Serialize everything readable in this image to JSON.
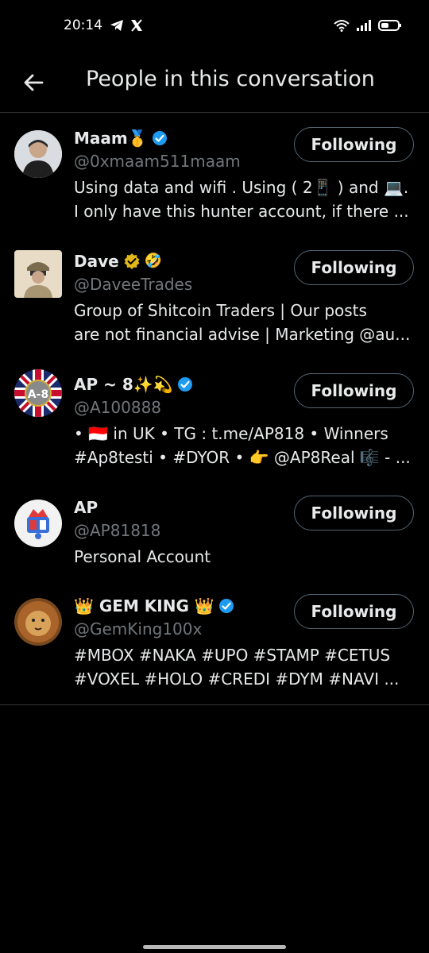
{
  "status": {
    "time": "20:14",
    "left_icons": [
      "telegram-icon",
      "x-logo-icon"
    ],
    "right_icons": [
      "wifi-icon",
      "signal-icon",
      "battery-icon"
    ]
  },
  "header": {
    "title": "People in this conversation",
    "back_icon": "back-arrow-icon"
  },
  "colors": {
    "background": "#000000",
    "text": "#e7e9ea",
    "muted": "#71767b",
    "verified_blue": "#1d9bf0",
    "verified_gold": "#e2b719",
    "divider": "#2f3336"
  },
  "people": [
    {
      "name": "Maam🥇",
      "badge": "verified-blue",
      "handle": "@0xmaam511maam",
      "bio": [
        "Using data and wifi . Using ( 2📱 ) and 💻.",
        "I only have this hunter account, if there ..."
      ],
      "button": "Following"
    },
    {
      "name": "Dave",
      "badge": "verified-gold",
      "extra_emoji": "🤣",
      "handle": "@DaveeTrades",
      "bio": [
        "Group of Shitcoin Traders | Our posts",
        "are not financial advise | Marketing @au..."
      ],
      "button": "Following"
    },
    {
      "name": "AP ~ 8✨💫",
      "badge": "verified-blue",
      "handle": "@A100888",
      "bio": [
        "• 🇮🇩 in UK  • TG : t.me/AP818 • Winners",
        "#Ap8testi • #DYOR • 👉 @AP8Real 🎼 - ..."
      ],
      "button": "Following"
    },
    {
      "name": "AP",
      "badge": "",
      "handle": "@AP81818",
      "bio": [
        "Personal Account"
      ],
      "button": "Following"
    },
    {
      "name": "👑 GEM KING 👑",
      "badge": "verified-blue",
      "handle": "@GemKing100x",
      "bio": [
        "#MBOX #NAKA #UPO #STAMP #CETUS",
        "#VOXEL #HOLO #CREDI #DYM #NAVI ..."
      ],
      "button": "Following"
    }
  ]
}
